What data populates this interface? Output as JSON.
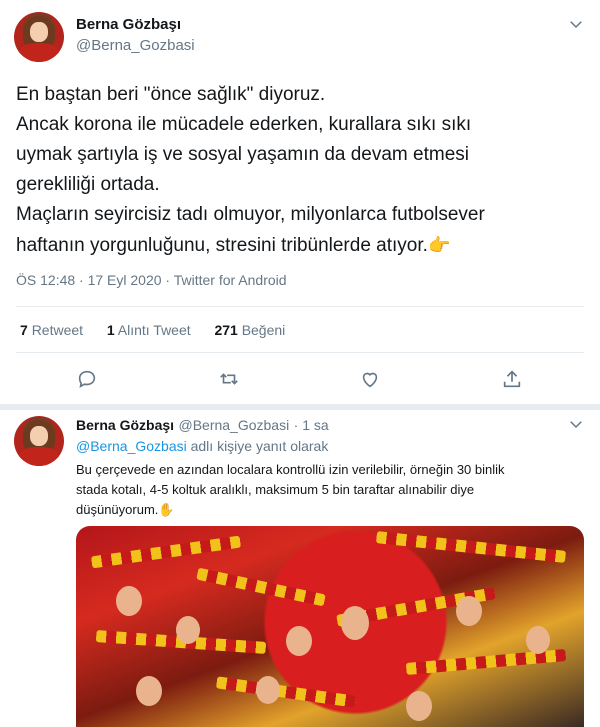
{
  "main_tweet": {
    "author_name": "Berna Gözbaşı",
    "author_handle": "@Berna_Gozbasi",
    "text_lines": [
      "En baştan beri \"önce sağlık\" diyoruz.",
      "Ancak korona ile mücadele ederken, kurallara sıkı sıkı",
      "uymak şartıyla iş ve sosyal yaşamın da devam etmesi",
      "gerekliliği ortada.",
      "Maçların seyircisiz tadı olmuyor, milyonlarca futbolsever",
      "haftanın yorgunluğunu, stresini tribünlerde atıyor."
    ],
    "emoji_icon": "backhand-index-pointing-left-emoji",
    "timestamp": "ÖS 12:48 · 17 Eyl 2020 · Twitter for Android",
    "stats": {
      "retweets_count": "7",
      "retweets_label": "Retweet",
      "quotes_count": "1",
      "quotes_label": "Alıntı Tweet",
      "likes_count": "271",
      "likes_label": "Beğeni"
    },
    "actions": [
      "reply-icon",
      "retweet-icon",
      "like-icon",
      "share-icon"
    ]
  },
  "reply_tweet": {
    "author_name": "Berna Gözbaşı",
    "author_handle": "@Berna_Gozbasi",
    "time_ago": "· 1 sa",
    "reply_to_handle": "@Berna_Gozbasi",
    "reply_to_suffix": " adlı kişiye yanıt olarak",
    "text_lines": [
      "Bu çerçevede en azından localara kontrollü izin verilebilir, örneğin 30 binlik",
      "stada kotalı, 4-5 koltuk aralıklı, maksimum 5 bin taraftar alınabilir diye",
      "düşünüyorum."
    ],
    "emoji_icon": "raised-hand-emoji",
    "media": "stadium-fans-photo"
  },
  "colors": {
    "text": "#14171a",
    "secondary": "#657786",
    "link": "#1b95e0",
    "divider": "#e6ecf0"
  }
}
